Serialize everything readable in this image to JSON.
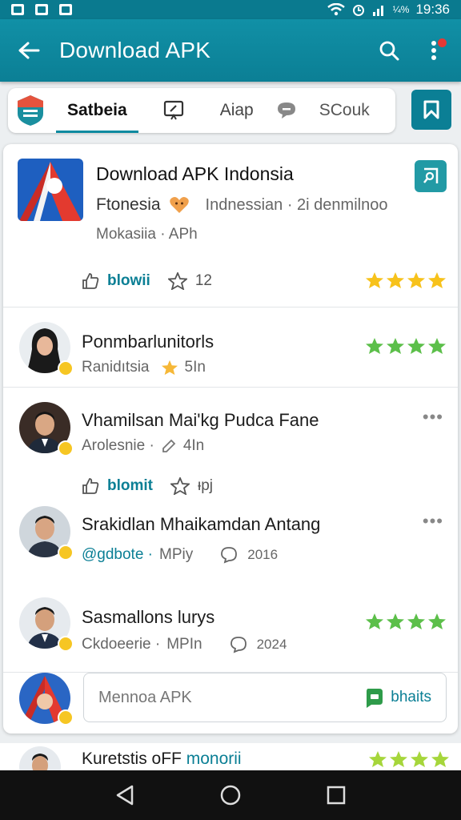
{
  "status_bar": {
    "time": "19:36",
    "battery": "¼%"
  },
  "app_bar": {
    "title": "Download APK"
  },
  "tabs": [
    {
      "label": "Satbeia",
      "active": true
    },
    {
      "label": ""
    },
    {
      "label": "Aiap"
    },
    {
      "label": ""
    },
    {
      "label": "SCouk"
    }
  ],
  "hero": {
    "title": "Download APK Indonsia",
    "subtitle": "Ftonesia",
    "subtitle_extra": "Indnessian · 2i denmilnoo",
    "meta": "Mokasiia · APh",
    "like_label": "blowii",
    "share_count": "12",
    "rating": 4,
    "star_color": "#f7c21b"
  },
  "posts": [
    {
      "name": "Ponmbarlunitorls",
      "sub": "Ranidıtsia",
      "sub_extra": "5In",
      "rating": 4,
      "star_color": "#5cbf4a"
    },
    {
      "name": "Vhamilsan Mai'kg Pudca Fane",
      "sub": "Arolesnie ·",
      "sub_extra": "4In",
      "like_label": "blomit",
      "share_count": "ᵼpj"
    },
    {
      "name": "Srakidlan Mhaikamdan Antang",
      "sub_link": "@gdbote ·",
      "sub_extra": "MPiy",
      "comment_count": "2016"
    },
    {
      "name": "Sasmallons lurys",
      "sub": "Ckdoeerie ·",
      "sub_extra": "MPIn",
      "comment_count": "2024",
      "rating": 4,
      "star_color": "#5cbf4a"
    }
  ],
  "composer": {
    "placeholder": "Mennoa APK",
    "button_label": "bhaits"
  },
  "peek": {
    "name": "Kuretstis oFF",
    "name_link": "monorii",
    "rating": 4,
    "star_color": "#a6d63b"
  },
  "nav": [
    "back",
    "home",
    "recents"
  ]
}
